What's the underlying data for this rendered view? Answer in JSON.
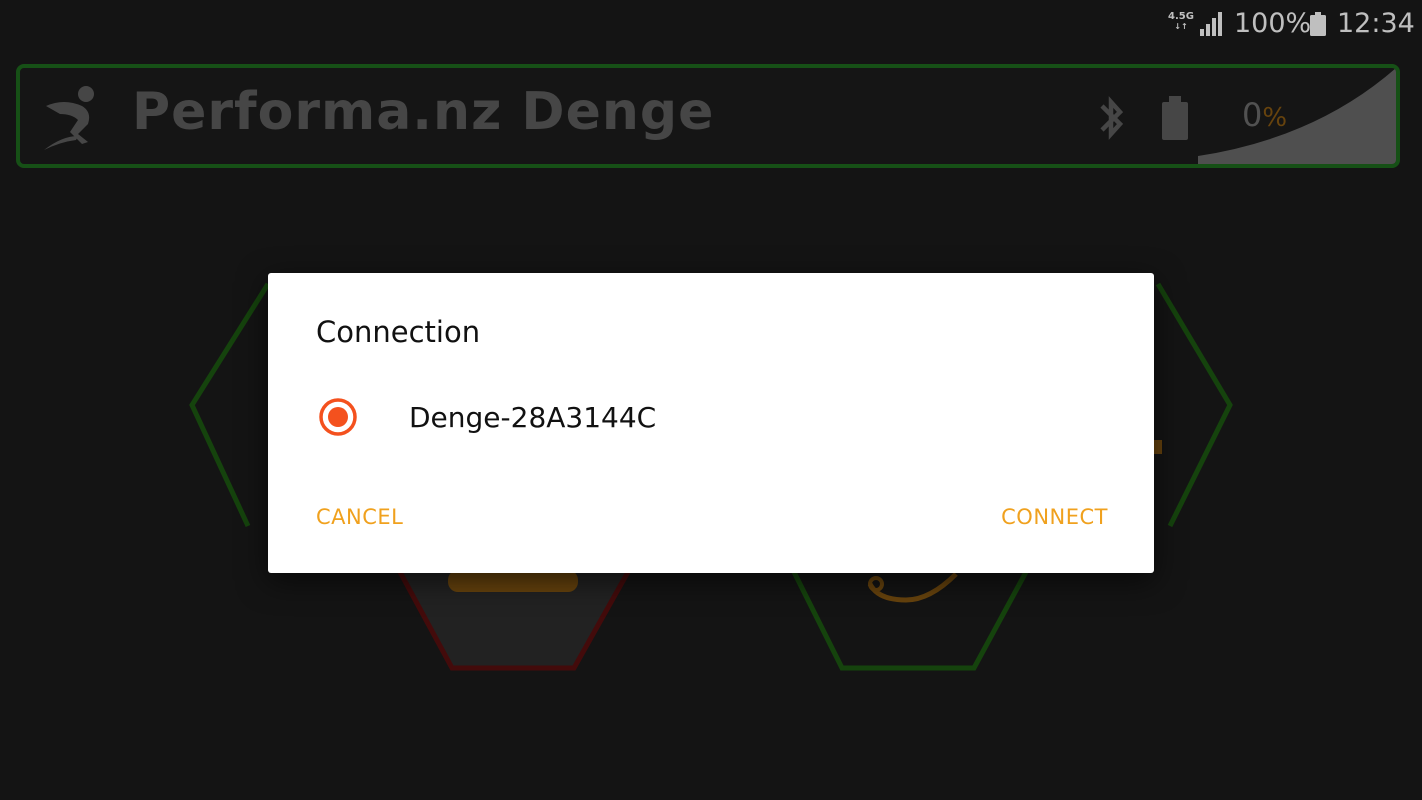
{
  "status_bar": {
    "network": "4.5G",
    "network_arrows": "↓↑",
    "battery_percent": "100%",
    "time": "12:34"
  },
  "header": {
    "title": "Performa.nz Denge",
    "device_battery_value": "0",
    "device_battery_unit": "%",
    "icons": [
      "performa-logo-icon",
      "bluetooth-icon",
      "device-battery-icon"
    ]
  },
  "dialog": {
    "title": "Connection",
    "options": [
      {
        "label": "Denge-28A3144C",
        "selected": true
      }
    ],
    "cancel_label": "CANCEL",
    "connect_label": "CONNECT"
  },
  "colors": {
    "background": "#1b1b1b",
    "header_border": "#1e6b1e",
    "accent_orange": "#f0a11e",
    "radio_orange": "#f4511e",
    "title_gray": "#5e5e5e",
    "hex_green": "#1e5a14",
    "hex_red": "#5a0f0f"
  }
}
